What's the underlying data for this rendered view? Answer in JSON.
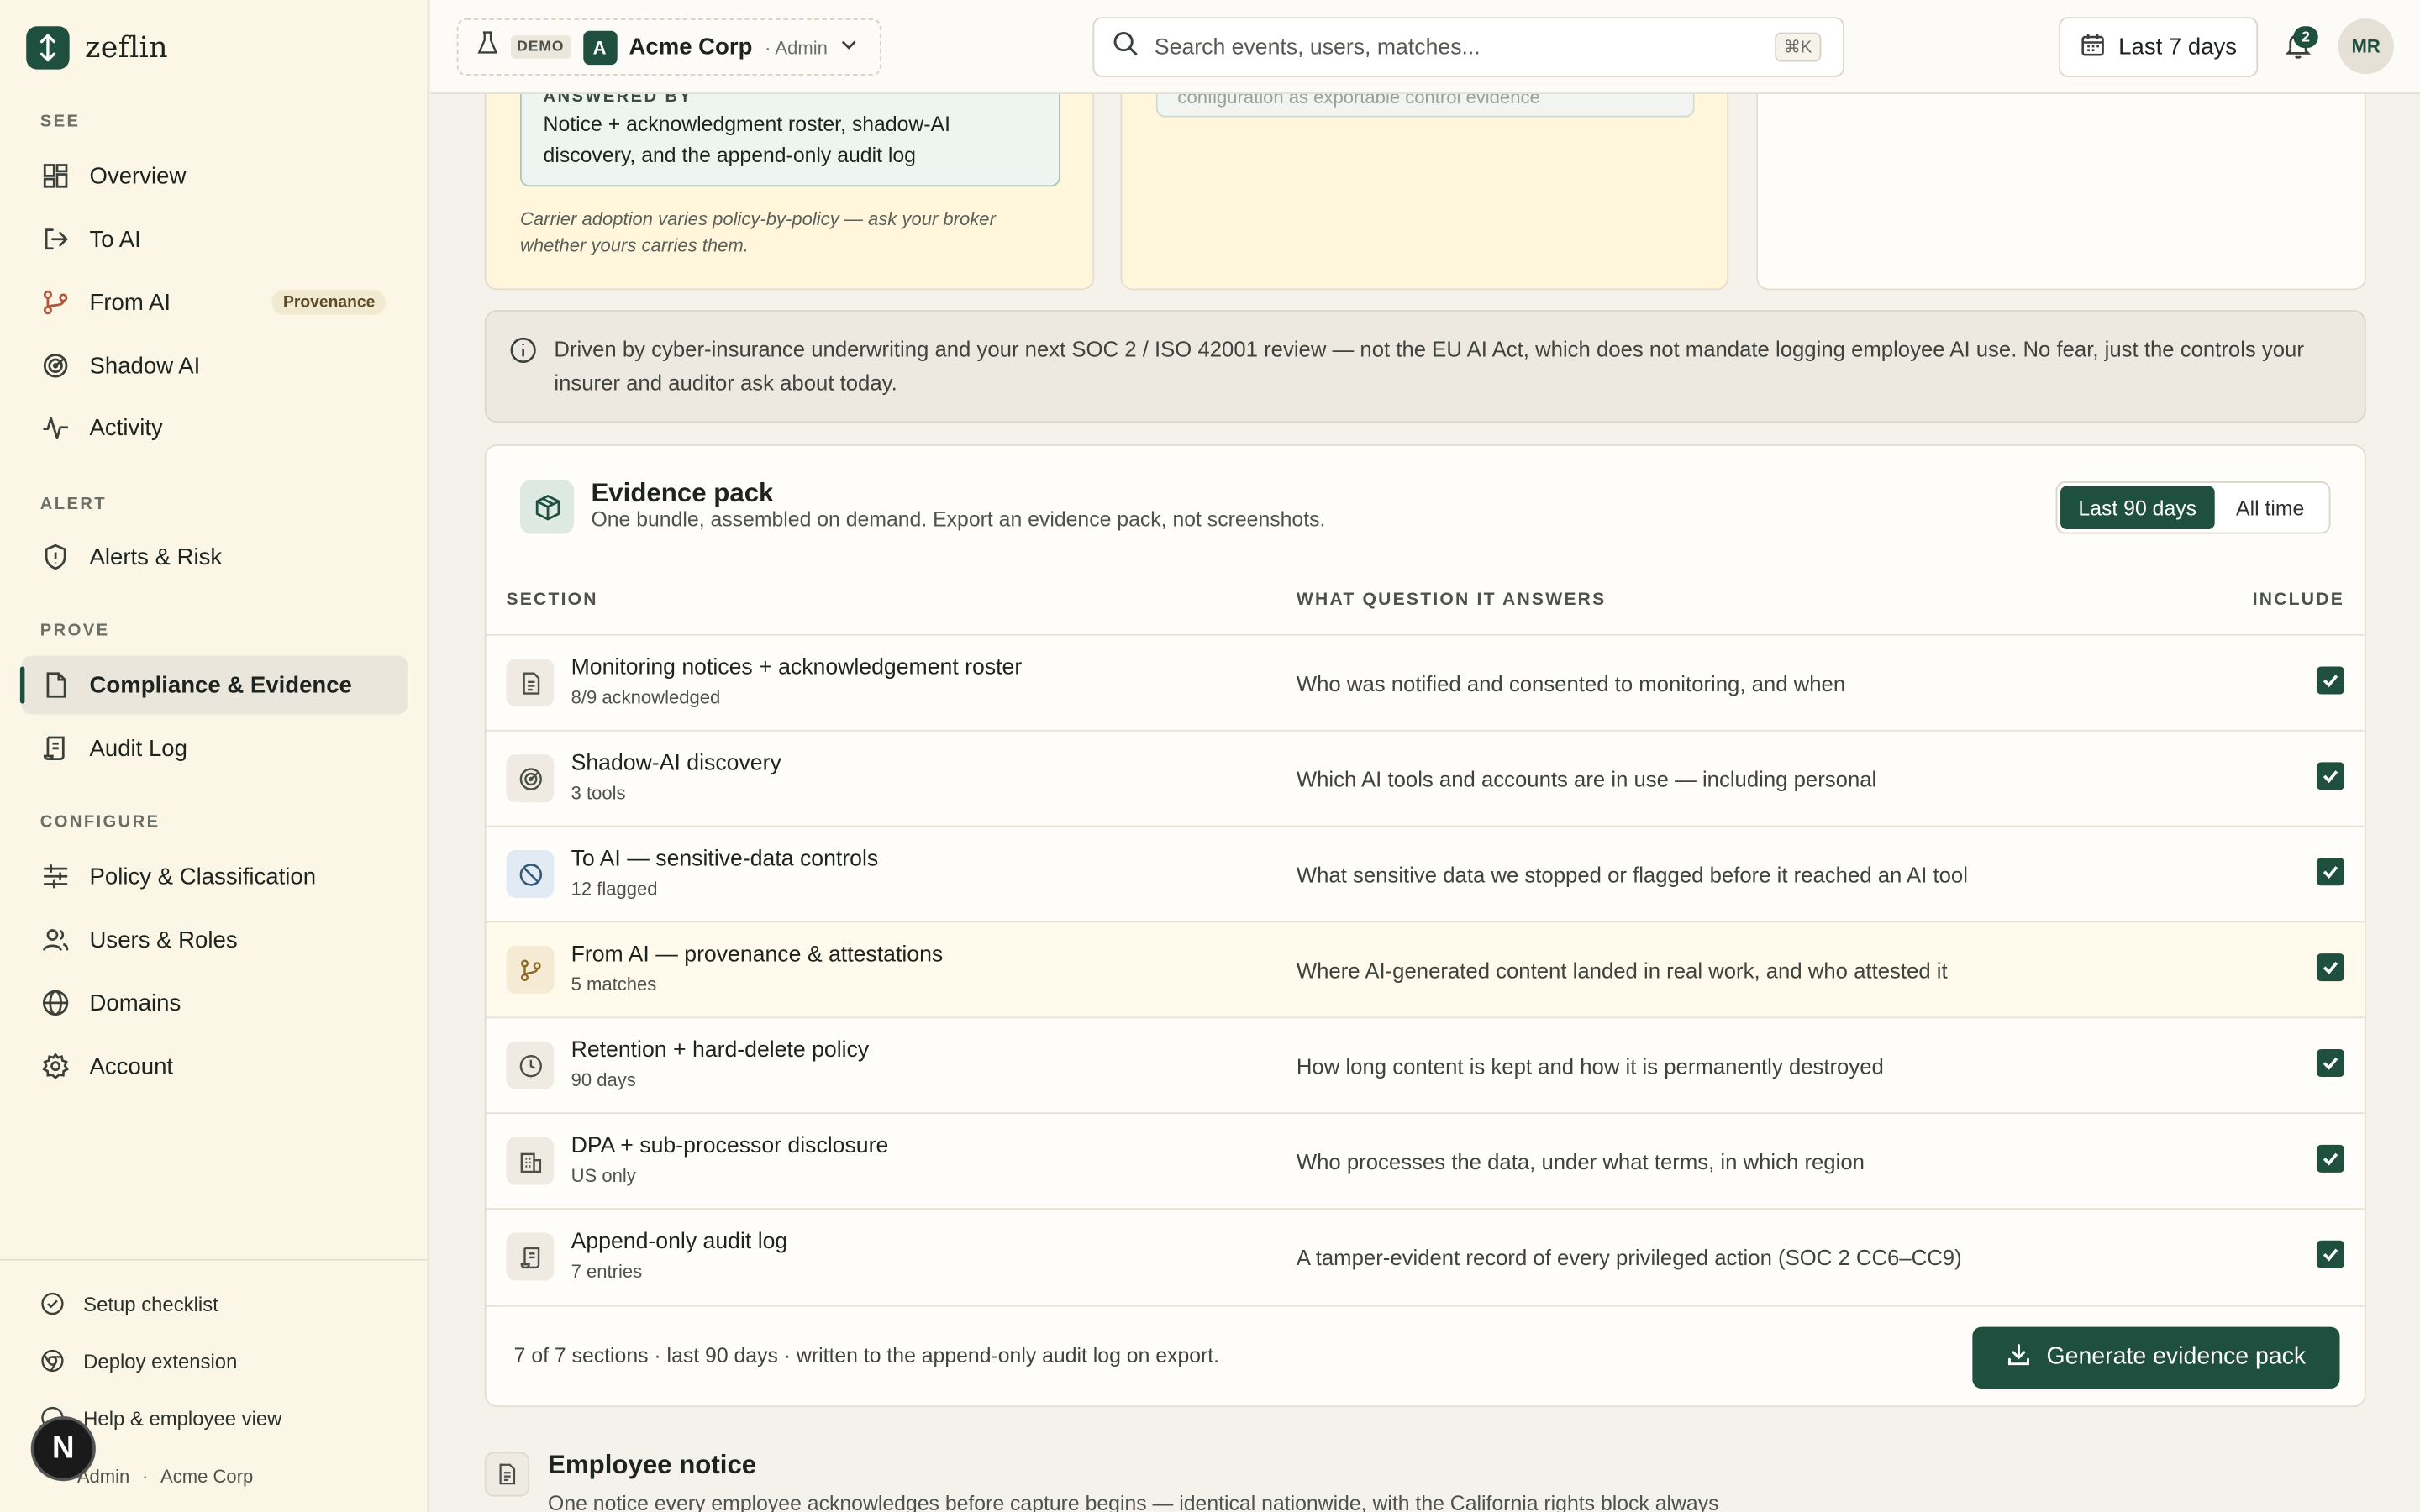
{
  "brand": {
    "name": "zeflin"
  },
  "sidebar": {
    "sections": {
      "see": "SEE",
      "alert": "ALERT",
      "prove": "PROVE",
      "configure": "CONFIGURE"
    },
    "items": {
      "overview": "Overview",
      "to_ai": "To AI",
      "from_ai": "From AI",
      "from_ai_badge": "Provenance",
      "shadow_ai": "Shadow AI",
      "activity": "Activity",
      "alerts": "Alerts & Risk",
      "compliance": "Compliance & Evidence",
      "audit_log": "Audit Log",
      "policy": "Policy & Classification",
      "users": "Users & Roles",
      "domains": "Domains",
      "account": "Account"
    },
    "footer": {
      "setup": "Setup checklist",
      "deploy": "Deploy extension",
      "help": "Help & employee view",
      "user_role": "Admin",
      "sep": "·",
      "user_org": "Acme Corp",
      "avatar_letter": "N"
    }
  },
  "topbar": {
    "demo": "DEMO",
    "org_initial": "A",
    "org_name": "Acme Corp",
    "org_role": "· Admin",
    "search_placeholder": "Search events, users, matches...",
    "search_shortcut": "⌘K",
    "range": "Last 7 days",
    "notif_count": "2",
    "avatar": "MR"
  },
  "top_cards": {
    "answered_label": "ANSWERED BY",
    "answered_text": "Notice + acknowledgment roster, shadow-AI discovery, and the append-only audit log",
    "carrier_note": "Carrier adoption varies policy-by-policy — ask your broker whether yours carries them.",
    "mid_snippet": "configuration as exportable control evidence"
  },
  "notice": {
    "text": "Driven by cyber-insurance underwriting and your next SOC 2 / ISO 42001 review — not the EU AI Act, which does not mandate logging employee AI use. No fear, just the controls your insurer and auditor ask about today."
  },
  "evidence": {
    "title": "Evidence pack",
    "subtitle": "One bundle, assembled on demand. Export an evidence pack, not screenshots.",
    "range_options": [
      "Last 90 days",
      "All time"
    ],
    "columns": {
      "section": "SECTION",
      "question": "WHAT QUESTION IT ANSWERS",
      "include": "INCLUDE"
    },
    "rows": [
      {
        "title": "Monitoring notices + acknowledgement roster",
        "meta": "8/9 acknowledged",
        "question": "Who was notified and consented to monitoring, and when",
        "icon": "document-icon",
        "included": true
      },
      {
        "title": "Shadow-AI discovery",
        "meta": "3 tools",
        "question": "Which AI tools and accounts are in use — including personal",
        "icon": "radar-icon",
        "included": true
      },
      {
        "title": "To AI — sensitive-data controls",
        "meta": "12 flagged",
        "question": "What sensitive data we stopped or flagged before it reached an AI tool",
        "icon": "block-icon",
        "included": true
      },
      {
        "title": "From AI — provenance & attestations",
        "meta": "5 matches",
        "question": "Where AI-generated content landed in real work, and who attested it",
        "icon": "branch-icon",
        "included": true
      },
      {
        "title": "Retention + hard-delete policy",
        "meta": "90 days",
        "question": "How long content is kept and how it is permanently destroyed",
        "icon": "clock-icon",
        "included": true
      },
      {
        "title": "DPA + sub-processor disclosure",
        "meta": "US only",
        "question": "Who processes the data, under what terms, in which region",
        "icon": "building-icon",
        "included": true
      },
      {
        "title": "Append-only audit log",
        "meta": "7 entries",
        "question": "A tamper-evident record of every privileged action (SOC 2 CC6–CC9)",
        "icon": "scroll-icon",
        "included": true
      }
    ],
    "footer_text": "7 of 7 sections · last 90 days · written to the append-only audit log on export.",
    "generate_label": "Generate evidence pack"
  },
  "employee_notice": {
    "title": "Employee notice",
    "subtitle": "One notice every employee acknowledges before capture begins — identical nationwide, with the California rights block always"
  }
}
